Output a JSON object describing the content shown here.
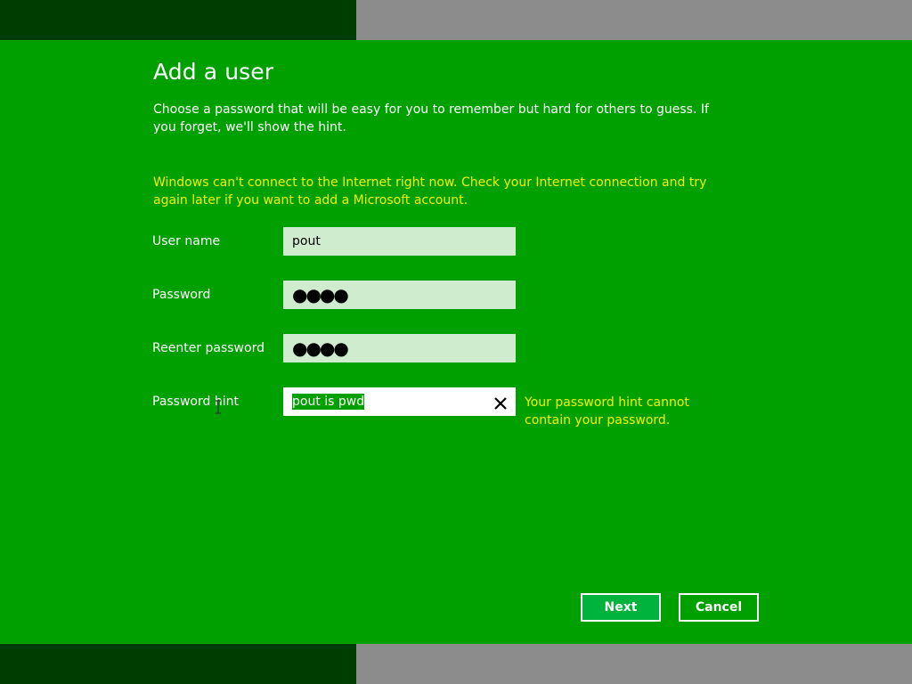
{
  "page": {
    "title": "Add a user",
    "intro": "Choose a password that will be easy for you to remember but hard for others to guess. If you forget, we'll show the hint.",
    "warning": "Windows can't connect to the Internet right now. Check your Internet connection and try again later if you want to add a Microsoft account."
  },
  "form": {
    "username": {
      "label": "User name",
      "value": "pout"
    },
    "password": {
      "label": "Password",
      "value": "●●●●"
    },
    "reenter_password": {
      "label": "Reenter password",
      "value": "●●●●"
    },
    "hint": {
      "label": "Password hint",
      "value": "pout is pwd",
      "error": "Your password hint cannot contain your password."
    }
  },
  "buttons": {
    "next": "Next",
    "cancel": "Cancel"
  },
  "colors": {
    "background": "#00a000",
    "warning_text": "#f2f200",
    "input_inactive": "#cfeccf",
    "next_button": "#00b33c",
    "band_dark": "#003d00",
    "band_gray": "#8c8c8c"
  },
  "icons": {
    "clear": "close-icon",
    "cursor": "text-cursor-icon"
  }
}
